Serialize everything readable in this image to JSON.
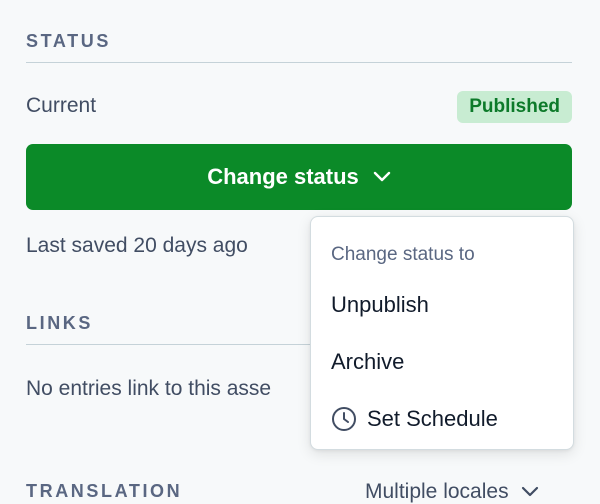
{
  "status": {
    "section_title": "STATUS",
    "current_label": "Current",
    "badge": "Published",
    "change_button": "Change status",
    "last_saved": "Last saved 20 days ago"
  },
  "links": {
    "section_title": "LINKS",
    "empty_text": "No entries link to this asse"
  },
  "translation": {
    "section_title": "TRANSLATION",
    "locales_label": "Multiple locales"
  },
  "dropdown": {
    "header": "Change status to",
    "items": [
      {
        "label": "Unpublish",
        "icon": ""
      },
      {
        "label": "Archive",
        "icon": ""
      },
      {
        "label": "Set Schedule",
        "icon": "clock-icon"
      }
    ]
  },
  "colors": {
    "primary_green": "#0b8a28",
    "badge_bg": "#c8ecd2",
    "badge_text": "#0d7a2a",
    "page_bg": "#f7f9fa"
  }
}
